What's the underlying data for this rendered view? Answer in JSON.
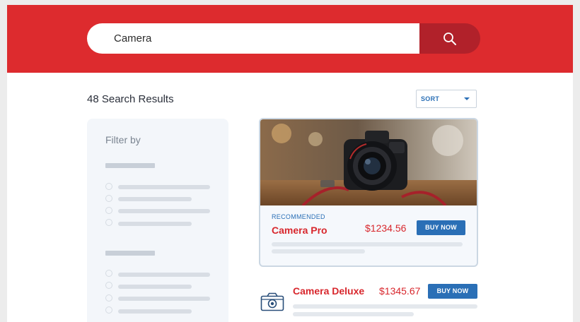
{
  "search": {
    "value": "Camera"
  },
  "results": {
    "count_label": "48 Search Results"
  },
  "sort": {
    "label": "SORT"
  },
  "filter": {
    "title": "Filter by"
  },
  "featured": {
    "badge": "RECOMMENDED",
    "name": "Camera Pro",
    "price": "$1234.56",
    "buy_label": "BUY NOW"
  },
  "items": [
    {
      "name": "Camera Deluxe",
      "price": "$1345.67",
      "buy_label": "BUY NOW",
      "icon": "camera-icon"
    }
  ],
  "colors": {
    "brand_red": "#dd2b2e",
    "brand_dark_red": "#b1212a",
    "accent_blue": "#2a6fb6",
    "price_red": "#d8272d"
  }
}
